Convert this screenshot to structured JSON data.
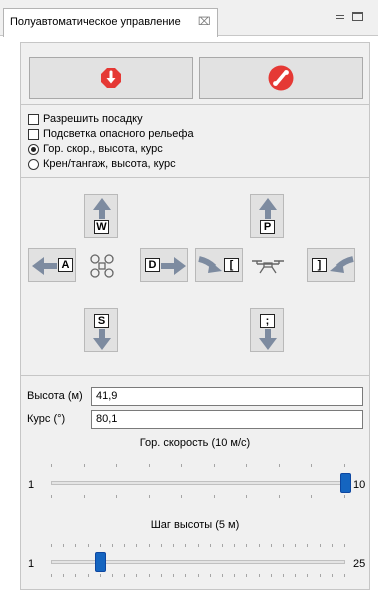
{
  "tab": {
    "title": "Полуавтоматическое управление",
    "close_glyph": "⌧"
  },
  "actions": {
    "land_icon": "red-octagon-down-arrow-icon",
    "cancel_icon": "red-circle-slash-icon",
    "icon_color": "#e53935"
  },
  "options": [
    {
      "kind": "checkbox",
      "label": "Разрешить посадку",
      "checked": false
    },
    {
      "kind": "checkbox",
      "label": "Подсветка опасного рельефа",
      "checked": false
    },
    {
      "kind": "radio",
      "label": "Гор. скор., высота, курс",
      "checked": true
    },
    {
      "kind": "radio",
      "label": "Крен/тангаж, высота, курс",
      "checked": false
    }
  ],
  "controls": {
    "key_forward": "W",
    "key_left": "A",
    "key_right": "D",
    "key_back": "S",
    "key_up": "P",
    "key_down": ";",
    "key_yaw_left": "[",
    "key_yaw_right": "]"
  },
  "fields": {
    "altitude_label": "Высота (м)",
    "altitude_value": "41,9",
    "heading_label": "Курс (°)",
    "heading_value": "80,1"
  },
  "sliders": {
    "speed": {
      "title": "Гор. скорость (10 м/с)",
      "min": "1",
      "max": "10",
      "value": 10
    },
    "alt_step": {
      "title": "Шаг высоты (5 м)",
      "min": "1",
      "max": "25",
      "value": 5
    }
  },
  "colors": {
    "arrow": "#7d8ba0",
    "slider_thumb": "#1565c0"
  }
}
